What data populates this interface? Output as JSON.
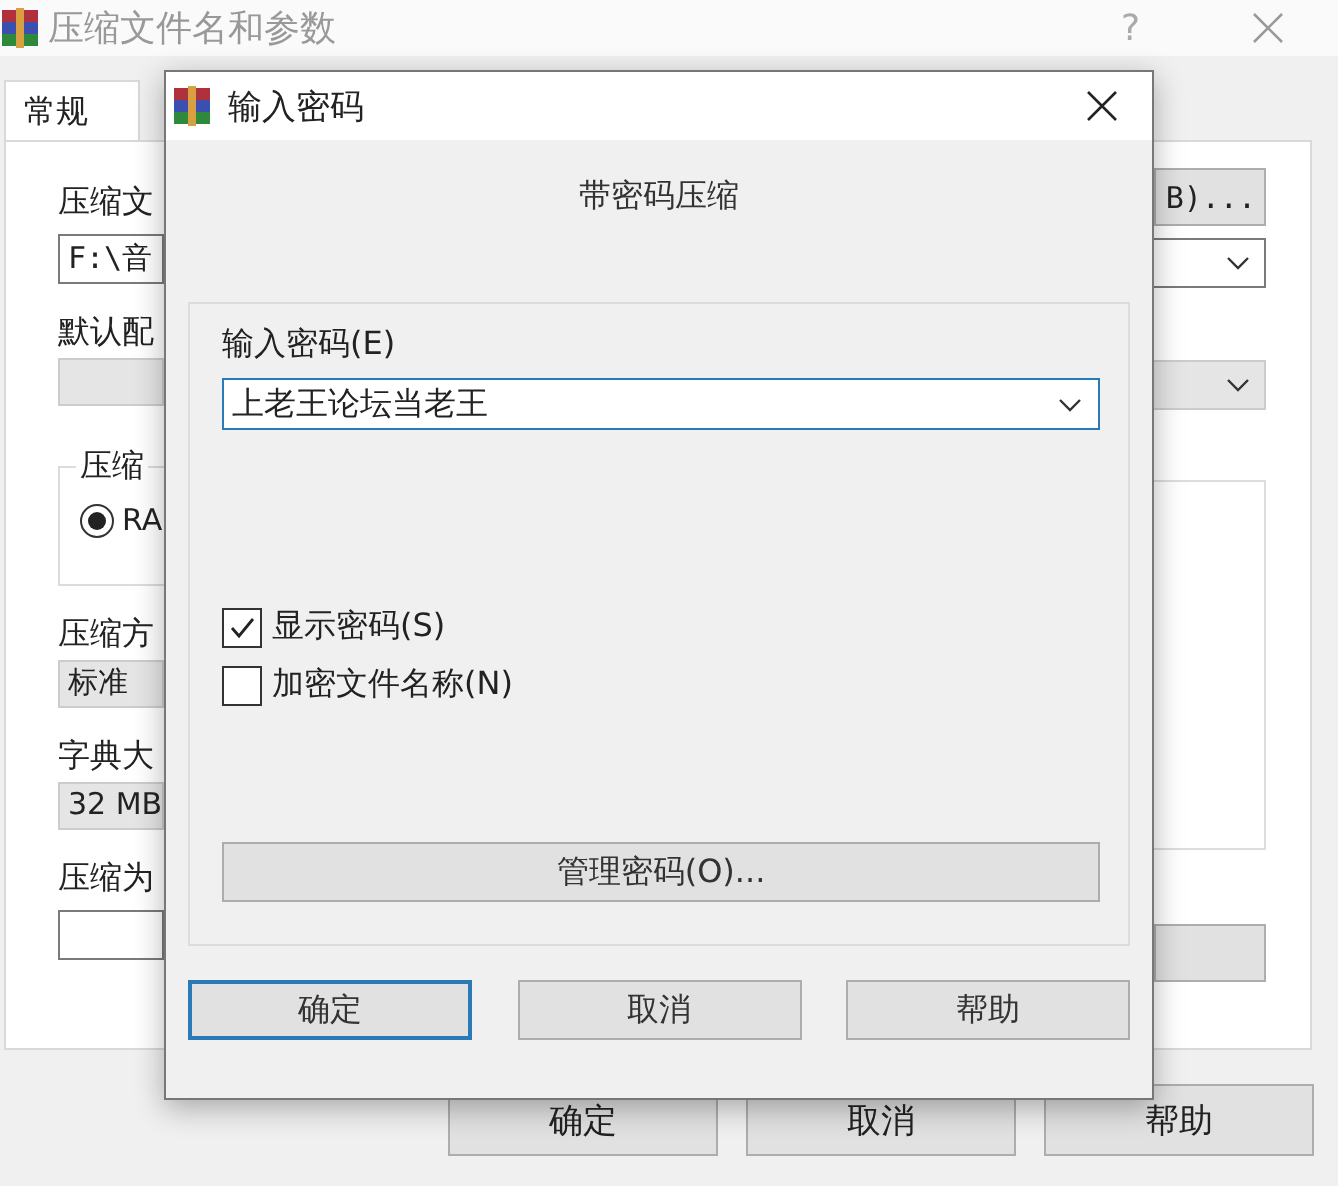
{
  "background_window": {
    "title": "压缩文件名和参数",
    "help": "?",
    "tabs": [
      {
        "label": "常规",
        "selected": true
      }
    ],
    "left_column": [
      {
        "kind": "label",
        "text": "压缩文"
      },
      {
        "kind": "input",
        "text": "F:\\音"
      },
      {
        "kind": "label",
        "text": "默认配"
      },
      {
        "kind": "combo"
      },
      {
        "kind": "group",
        "text": "压缩",
        "radio": {
          "label": "RA",
          "selected": true
        }
      },
      {
        "kind": "label",
        "text": "压缩方"
      },
      {
        "kind": "combo",
        "text": "标准"
      },
      {
        "kind": "label",
        "text": "字典大"
      },
      {
        "kind": "combo",
        "text": "32 MB"
      },
      {
        "kind": "label",
        "text": "压缩为"
      },
      {
        "kind": "input"
      }
    ],
    "right_column": [
      {
        "kind": "button",
        "text": "B)..."
      },
      {
        "kind": "dropdown"
      },
      {
        "kind": "gray-dropdown"
      },
      {
        "kind": "list"
      },
      {
        "kind": "button"
      }
    ],
    "buttons": [
      "确定",
      "取消",
      "帮助"
    ]
  },
  "dialog": {
    "title": "输入密码",
    "heading": "带密码压缩",
    "password_label": "输入密码(E)",
    "password": {
      "value": "上老王论坛当老王",
      "focused": true
    },
    "options": [
      {
        "label": "显示密码(S)",
        "checked": true
      },
      {
        "label": "加密文件名称(N)",
        "checked": false
      }
    ],
    "manage_button": "管理密码(O)...",
    "buttons": [
      {
        "label": "确定",
        "default": true
      },
      {
        "label": "取消",
        "default": false
      },
      {
        "label": "帮助",
        "default": false
      }
    ]
  }
}
